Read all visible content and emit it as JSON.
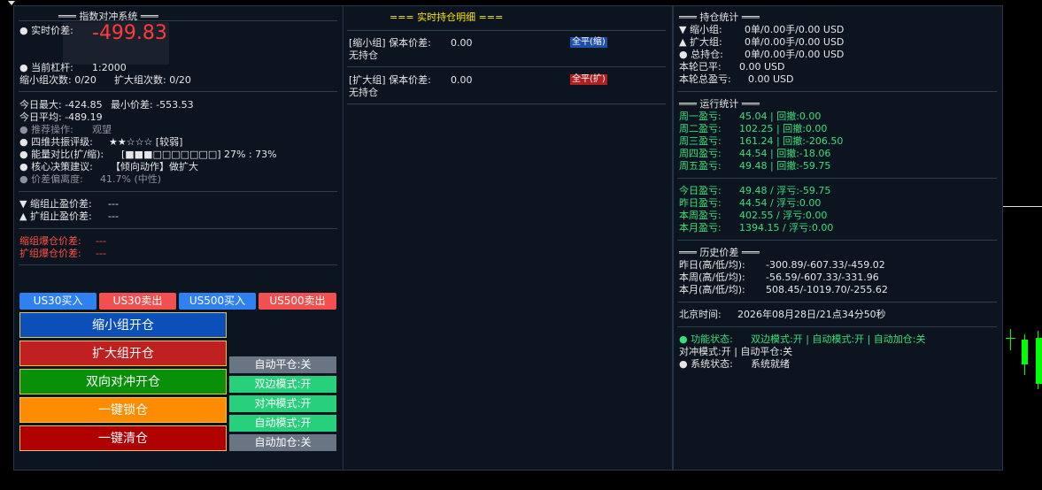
{
  "left": {
    "title": "═══ 指数对冲系统 ═══",
    "realtime_label": "实时价差:",
    "realtime_value": "-499.83",
    "leverage_label": "当前杠杆:",
    "leverage_value": "1:2000",
    "shrink_count": "缩小组次数: 0/20",
    "expand_count": "扩大组次数: 0/20",
    "today_max": "今日最大: -424.85",
    "min_spread": "最小价差: -553.53",
    "today_avg": "今日平均: -489.19",
    "recommend_label": "推荐操作:",
    "recommend_value": "观望",
    "resonance_label": "四维共振评级:",
    "resonance_value": "★★☆☆☆ [较弱]",
    "energy_label": "能量对比(扩/缩):",
    "energy_value": "[■■■□□□□□□□] 27% : 73%",
    "core_label": "核心决策建议:",
    "core_value": "【倾向动作】做扩大",
    "deviation_label": "价差偏离度:",
    "deviation_value": "41.7% (中性)",
    "shrink_tp_label": "▼ 缩组止盈价差:",
    "shrink_tp_value": "---",
    "expand_tp_label": "▲ 扩组止盈价差:",
    "expand_tp_value": "---",
    "shrink_liq_label": "缩组爆仓价差:",
    "shrink_liq_value": "---",
    "expand_liq_label": "扩组爆仓价差:",
    "expand_liq_value": "---",
    "btn_us30_buy": "US30买入",
    "btn_us30_sell": "US30卖出",
    "btn_us500_buy": "US500买入",
    "btn_us500_sell": "US500卖出",
    "btn_shrink_open": "缩小组开仓",
    "btn_expand_open": "扩大组开仓",
    "btn_hedge_open": "双向对冲开仓",
    "btn_lock": "一键锁仓",
    "btn_clear": "一键清仓",
    "toggle_auto_close": "自动平仓:关",
    "toggle_bilateral": "双边模式:开",
    "toggle_hedge": "对冲模式:开",
    "toggle_auto_mode": "自动模式:开",
    "toggle_auto_add": "自动加仓:关"
  },
  "middle": {
    "title": "=== 实时持仓明细 ===",
    "shrink_header": "[缩小组] 保本价差:",
    "shrink_value": "0.00",
    "shrink_tag": "全平(缩)",
    "shrink_status": "无持仓",
    "expand_header": "[扩大组] 保本价差:",
    "expand_value": "0.00",
    "expand_tag": "全平(扩)",
    "expand_status": "无持仓"
  },
  "right": {
    "pos_title": "═══ 持仓统计 ═══",
    "pos_shrink_label": "▼ 缩小组:",
    "pos_shrink_value": "0单/0.00手/0.00 USD",
    "pos_expand_label": "▲ 扩大组:",
    "pos_expand_value": "0单/0.00手/0.00 USD",
    "pos_total_label": "总持仓:",
    "pos_total_value": "0单/0.00手/0.00 USD",
    "round_closed_label": "本轮已平:",
    "round_closed_value": "0.00 USD",
    "round_total_label": "本轮总盈亏:",
    "round_total_value": "0.00 USD",
    "run_title": "═══ 运行统计 ═══",
    "weeks": [
      {
        "label": "周一盈亏:",
        "value": "45.04 | 回撤:0.00"
      },
      {
        "label": "周二盈亏:",
        "value": "102.25 | 回撤:0.00"
      },
      {
        "label": "周三盈亏:",
        "value": "161.24 | 回撤:-206.50"
      },
      {
        "label": "周四盈亏:",
        "value": "44.54 | 回撤:-18.06"
      },
      {
        "label": "周五盈亏:",
        "value": "49.48 | 回撤:-59.75"
      }
    ],
    "periods": [
      {
        "label": "今日盈亏:",
        "value": "49.48 / 浮亏:-59.75"
      },
      {
        "label": "昨日盈亏:",
        "value": "44.54 / 浮亏:0.00"
      },
      {
        "label": "本周盈亏:",
        "value": "402.55 / 浮亏:0.00"
      },
      {
        "label": "本月盈亏:",
        "value": "1394.15 / 浮亏:0.00"
      }
    ],
    "hist_title": "═══ 历史价差 ═══",
    "hist": [
      {
        "label": "昨日(高/低/均):",
        "value": "-300.89/-607.33/-459.02"
      },
      {
        "label": "本周(高/低/均):",
        "value": "-56.59/-607.33/-331.96"
      },
      {
        "label": "本月(高/低/均):",
        "value": "508.45/-1019.70/-255.62"
      }
    ],
    "time_label": "北京时间:",
    "time_value": "2026年08月28日/21点34分50秒",
    "func_label": "功能状态:",
    "func_value": "双边模式:开 | 自动模式:开 | 自动加仓:关",
    "func_line2": "对冲模式:开 | 自动平仓:关",
    "sys_label": "系统状态:",
    "sys_value": "系统就绪"
  }
}
